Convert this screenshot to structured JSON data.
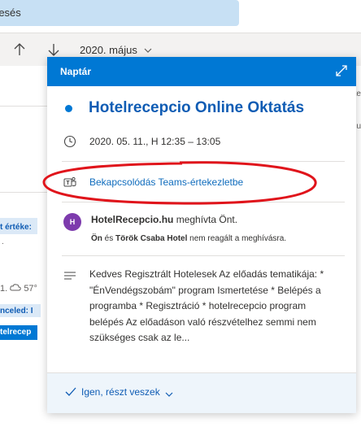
{
  "search": {
    "text": "resés"
  },
  "nav": {
    "month_label": "2020. május"
  },
  "background_events": {
    "stub1": "t értéke:",
    "stub2": ".",
    "weather": "57°",
    "canceled": "nceled: I",
    "chip": "telrecep",
    "right_stub1": "te",
    "right_stub2": "cu"
  },
  "popup": {
    "header_title": "Naptár",
    "event_title": "Hotelrecepcio Online Oktatás",
    "datetime": "2020. 05. 11., H 12:35 – 13:05",
    "teams_link": "Bekapcsolódás Teams-értekezletbe",
    "organizer": {
      "avatar_letter": "H",
      "name": "HotelRecepcio.hu",
      "invited_text": "meghívta Önt.",
      "status_you": "Ön",
      "status_and": "és",
      "status_other": "Török Csaba Hotel",
      "status_text": "nem reagált a meghívásra."
    },
    "description": "Kedves Regisztrált Hotelesek Az előadás tematikája: * \"ÉnVendégszobám\" program Ismertetése * Belépés a programba * Regisztráció * hotelrecepcio program belépés Az előadáson való részvételhez semmi nem szükséges csak az le...",
    "response_label": "Igen, részt veszek"
  },
  "colors": {
    "accent": "#0078d4",
    "title_blue": "#0f5cb4",
    "avatar": "#7d3bad",
    "annotation": "#e0141b"
  },
  "icons": [
    "arrow-up-icon",
    "arrow-down-icon",
    "chevron-down-icon",
    "expand-icon",
    "clock-icon",
    "teams-icon",
    "description-lines-icon",
    "checkmark-icon",
    "cloud-icon"
  ]
}
